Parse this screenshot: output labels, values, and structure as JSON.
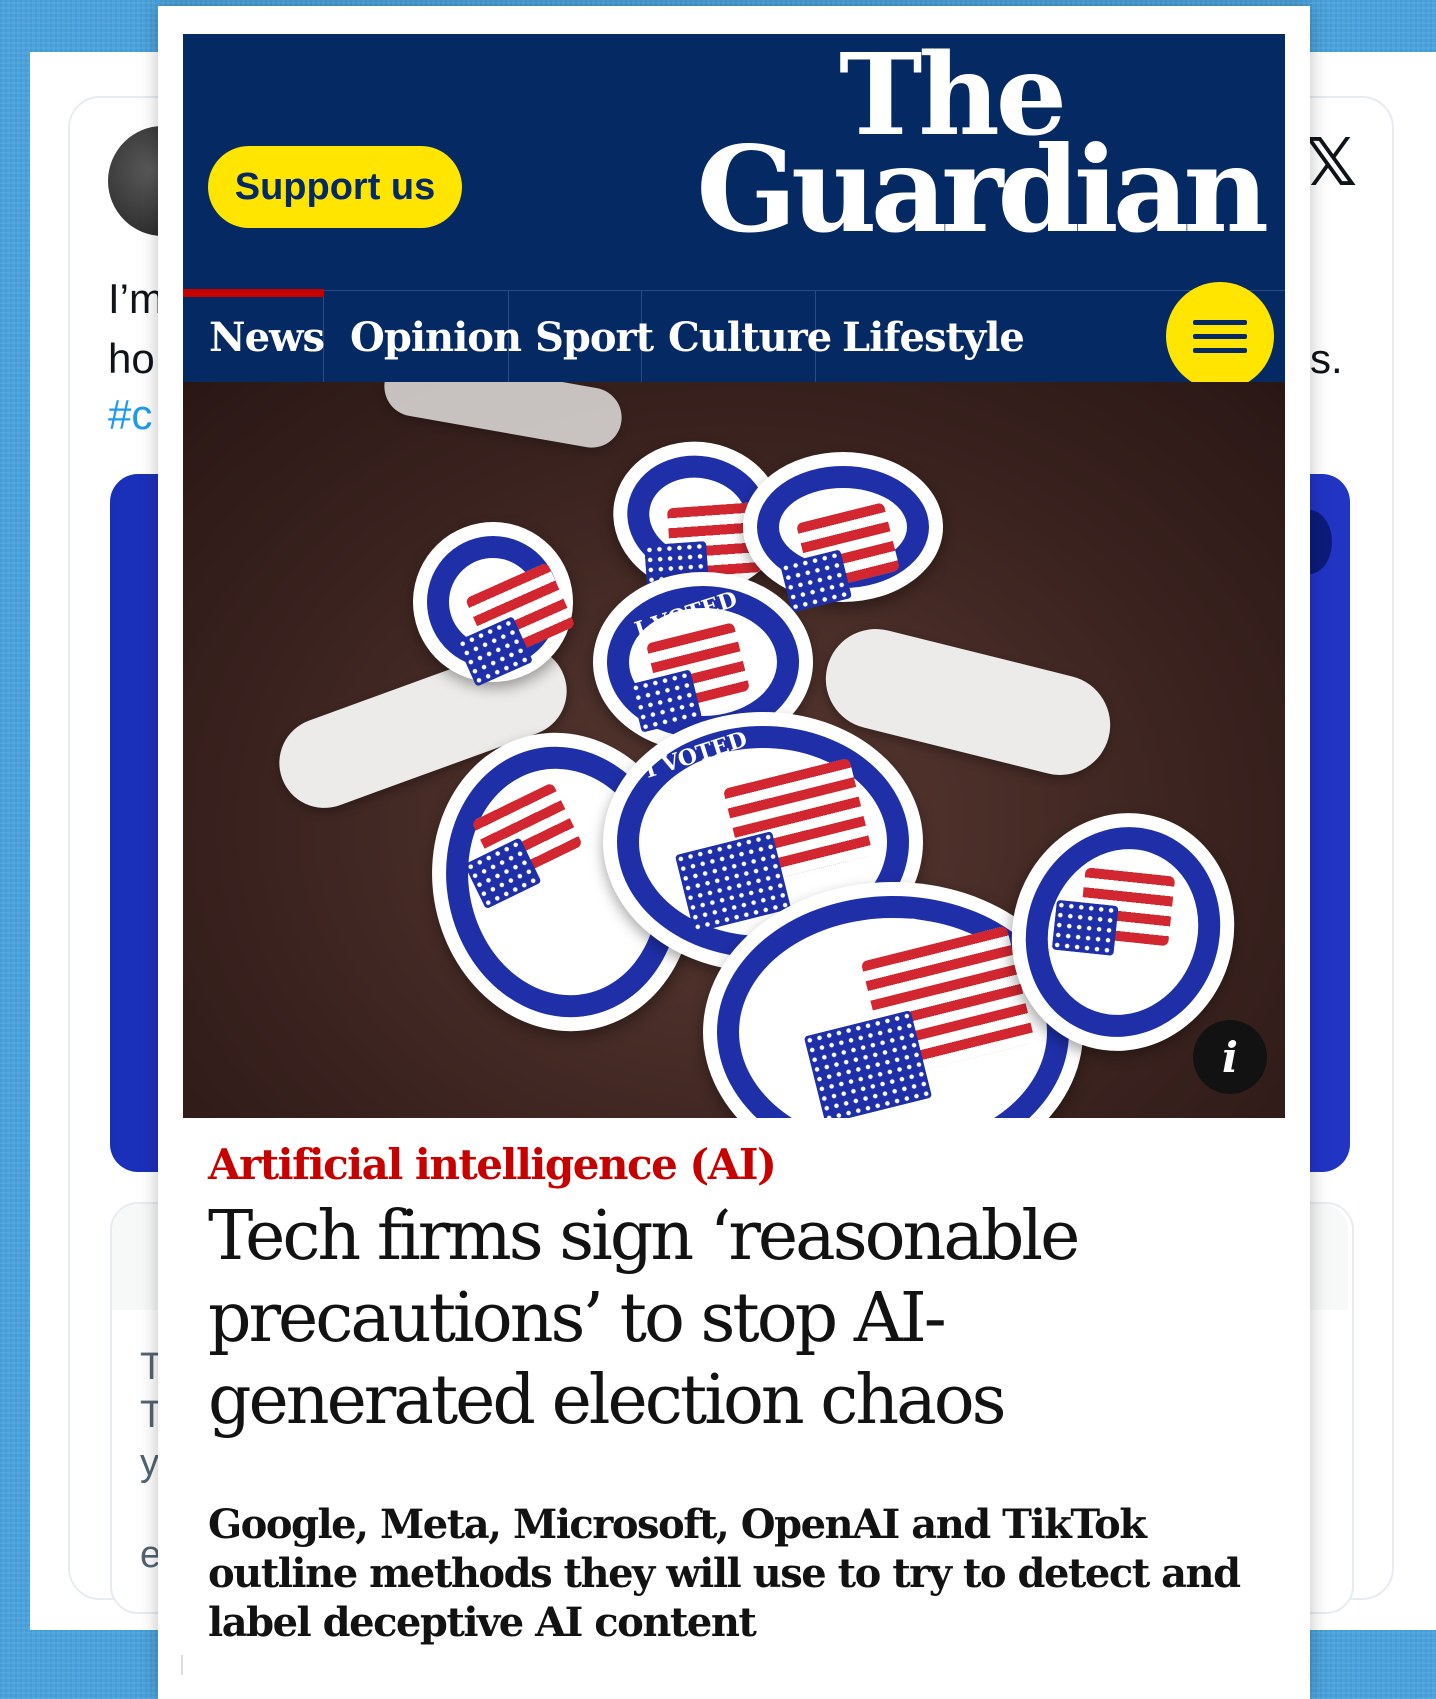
{
  "background_tweet": {
    "text_line1": "I’m",
    "text_line2": "ho",
    "text_line3": "#c",
    "text_right": "s.",
    "x_icon": "x-logo-icon",
    "quote_line1": "T",
    "quote_line2": "T",
    "quote_line3": "y",
    "quote_link": "e"
  },
  "header": {
    "support_label": "Support us",
    "logo_line1": "The",
    "logo_line2": "Guardian",
    "brand_color": "#052962",
    "accent_color": "#ffe500"
  },
  "nav": {
    "items": [
      {
        "label": "News",
        "active": true
      },
      {
        "label": "Opinion"
      },
      {
        "label": "Sport"
      },
      {
        "label": "Culture"
      },
      {
        "label": "Lifestyle"
      }
    ],
    "menu_icon": "hamburger-menu-icon",
    "active_color": "#c70000"
  },
  "hero": {
    "sticker_text": "I VOTED",
    "info_label": "i"
  },
  "article": {
    "kicker": "Artificial intelligence (AI)",
    "headline": "Tech firms sign ‘reasonable precautions’ to stop AI-generated election chaos",
    "standfirst": "Google, Meta, Microsoft, OpenAI and TikTok outline methods they will use to try to detect and label deceptive AI content"
  }
}
